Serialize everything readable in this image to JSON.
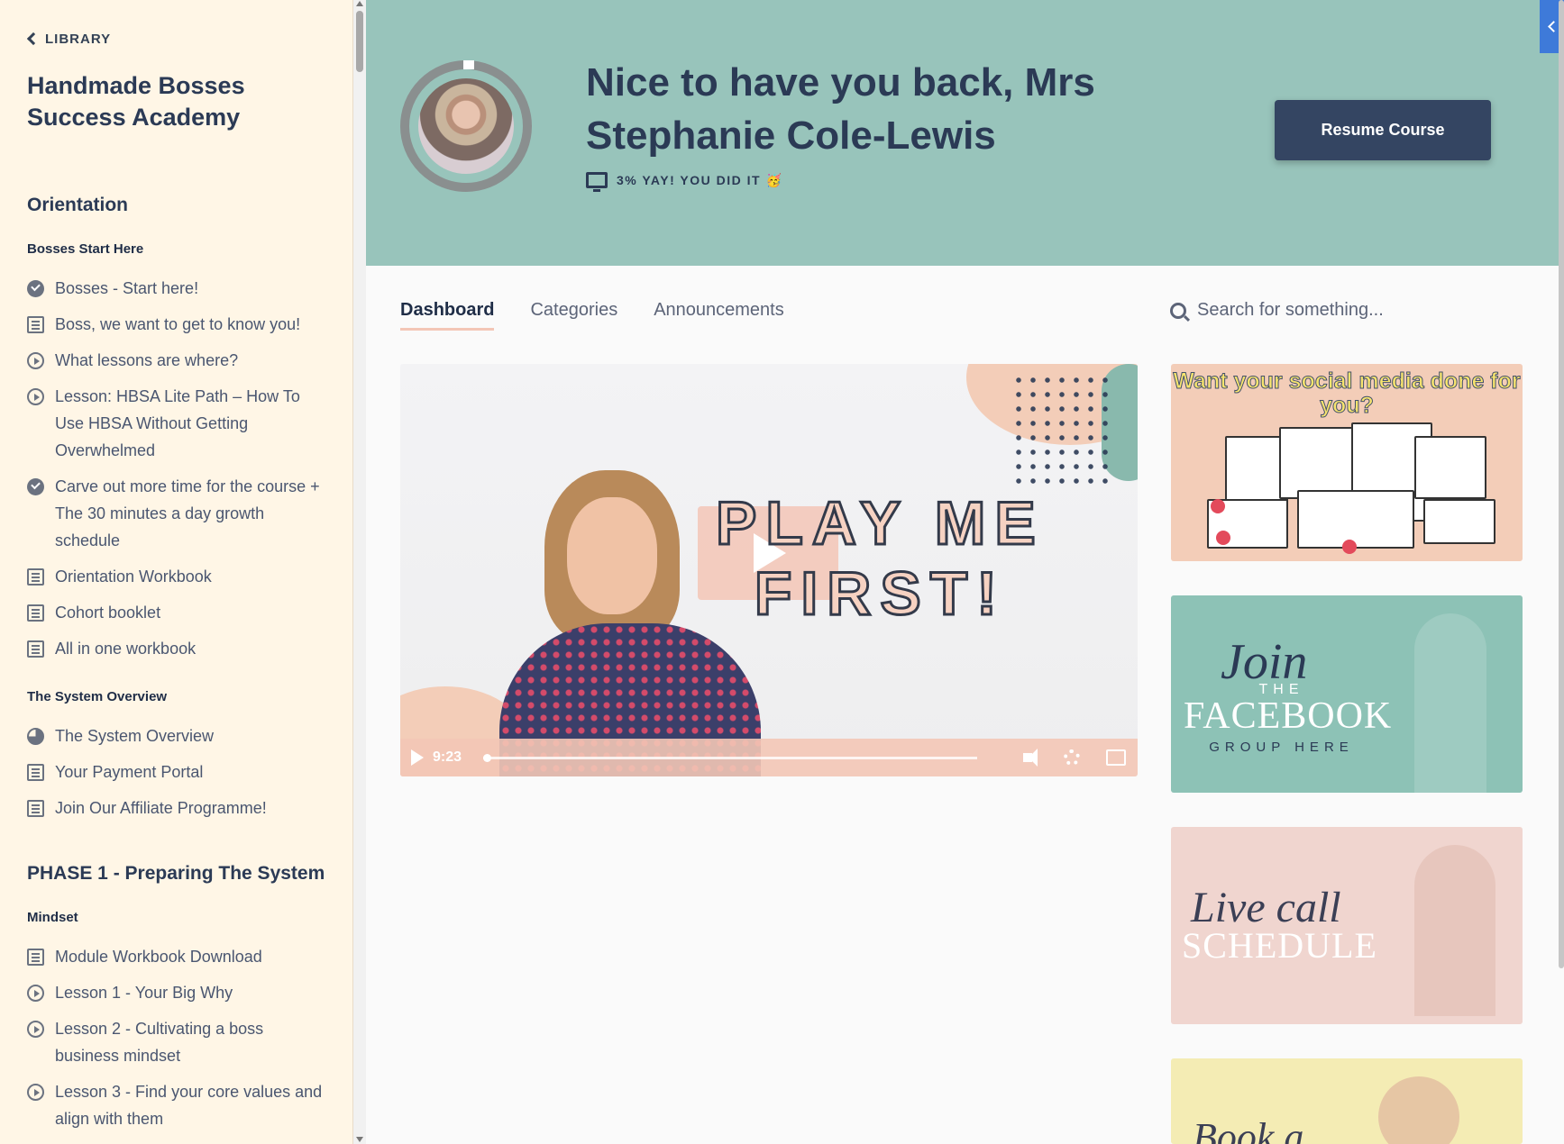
{
  "sidebar": {
    "back_label": "LIBRARY",
    "course_title": "Handmade Bosses Success Academy",
    "phases": [
      {
        "title": "Orientation",
        "sections": [
          {
            "title": "Bosses Start Here",
            "items": [
              {
                "label": "Bosses - Start here!",
                "icon": "check-circle-icon",
                "status": "completed"
              },
              {
                "label": "Boss, we want to get to know you!",
                "icon": "document-icon",
                "status": "incomplete"
              },
              {
                "label": "What lessons are where?",
                "icon": "play-circle-icon",
                "status": "incomplete"
              },
              {
                "label": "Lesson: HBSA Lite Path – How To Use HBSA Without Getting Overwhelmed",
                "icon": "play-circle-icon",
                "status": "incomplete"
              },
              {
                "label": "Carve out more time for the course + The 30 minutes a day growth schedule",
                "icon": "check-circle-icon",
                "status": "completed"
              },
              {
                "label": "Orientation Workbook",
                "icon": "document-icon",
                "status": "incomplete"
              },
              {
                "label": "Cohort booklet",
                "icon": "document-icon",
                "status": "incomplete"
              },
              {
                "label": "All in one workbook",
                "icon": "document-icon",
                "status": "incomplete"
              }
            ]
          },
          {
            "title": "The System Overview",
            "items": [
              {
                "label": "The System Overview",
                "icon": "partial-progress-icon",
                "status": "in-progress"
              },
              {
                "label": "Your Payment Portal",
                "icon": "document-icon",
                "status": "incomplete"
              },
              {
                "label": "Join Our Affiliate Programme!",
                "icon": "document-icon",
                "status": "incomplete"
              }
            ]
          }
        ]
      },
      {
        "title": "PHASE 1 - Preparing The System",
        "sections": [
          {
            "title": "Mindset",
            "items": [
              {
                "label": "Module Workbook Download",
                "icon": "document-icon",
                "status": "incomplete"
              },
              {
                "label": "Lesson 1 - Your Big Why",
                "icon": "play-circle-icon",
                "status": "incomplete"
              },
              {
                "label": "Lesson 2 - Cultivating a boss business mindset",
                "icon": "play-circle-icon",
                "status": "incomplete"
              },
              {
                "label": "Lesson 3 - Find your core values and align with them",
                "icon": "play-circle-icon",
                "status": "incomplete"
              }
            ]
          }
        ]
      }
    ]
  },
  "header": {
    "welcome": "Nice to have you back, Mrs Stephanie Cole-Lewis",
    "progress_text": "3% YAY! YOU DID IT 🥳",
    "progress_percent": 3,
    "resume_label": "Resume Course",
    "colors": {
      "header_bg": "#98c4bb",
      "button_bg": "#344562"
    }
  },
  "tabs": [
    {
      "label": "Dashboard",
      "active": true
    },
    {
      "label": "Categories",
      "active": false
    },
    {
      "label": "Announcements",
      "active": false
    }
  ],
  "search": {
    "placeholder": "Search for something..."
  },
  "video": {
    "title_text": "PLAY ME FIRST!",
    "duration": "9:23",
    "progress": 0
  },
  "promos": {
    "card1": {
      "text": "Want your social media done for you?"
    },
    "card2": {
      "script": "Join",
      "the": "THE",
      "headline": "FACEBOOK",
      "tail": "GROUP HERE"
    },
    "card3": {
      "script": "Live call",
      "headline": "SCHEDULE"
    },
    "card4": {
      "script": "Book a"
    }
  }
}
